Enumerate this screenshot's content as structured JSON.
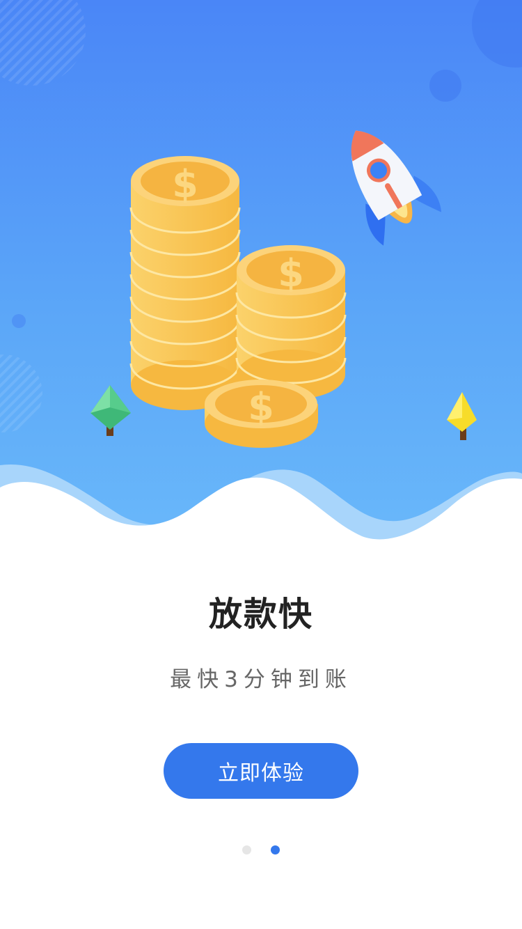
{
  "slide": {
    "title": "放款快",
    "subtitle": "最快3分钟到账",
    "cta_label": "立即体验"
  },
  "pager": {
    "total": 2,
    "active_index": 1
  },
  "colors": {
    "primary": "#3478ec",
    "hero_top": "#4a86f7",
    "hero_bottom": "#6ab9fa",
    "coin": "#f7c254",
    "coin_face": "#f5b441",
    "title": "#222222",
    "subtitle": "#666666",
    "dot_inactive": "#e6e6e6"
  },
  "illustration": {
    "icons": [
      "coin-stack-icon",
      "rocket-icon",
      "tree-icon",
      "wave-shape"
    ]
  }
}
